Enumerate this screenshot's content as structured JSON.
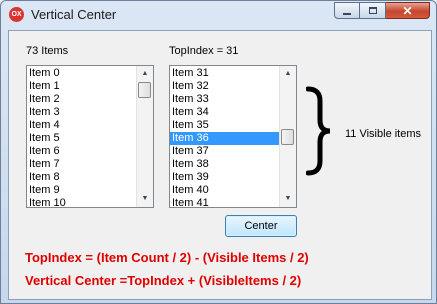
{
  "window": {
    "title": "Vertical Center",
    "icon_text": "OX",
    "minimize_label": "Minimize",
    "maximize_label": "Maximize",
    "close_label": "✕"
  },
  "left_list": {
    "header": "73 Items",
    "items": [
      "Item 0",
      "Item 1",
      "Item 2",
      "Item 3",
      "Item 4",
      "Item 5",
      "Item 6",
      "Item 7",
      "Item 8",
      "Item 9",
      "Item 10"
    ],
    "scroll_fraction": 0
  },
  "right_list": {
    "header": "TopIndex = 31",
    "items": [
      "Item 31",
      "Item 32",
      "Item 33",
      "Item 34",
      "Item 35",
      "Item 36",
      "Item 37",
      "Item 38",
      "Item 39",
      "Item 40",
      "Item 41"
    ],
    "selected_index": 5,
    "scroll_fraction": 0.5
  },
  "visible_items_label": "11 Visible items",
  "center_button_label": "Center",
  "formulas": {
    "top_index": "TopIndex = (Item Count / 2) - (Visible Items / 2)",
    "vertical_center": "Vertical Center =TopIndex + (VisibleItems / 2)"
  },
  "colors": {
    "formula_text": "#e00000",
    "selection": "#3399ff"
  }
}
